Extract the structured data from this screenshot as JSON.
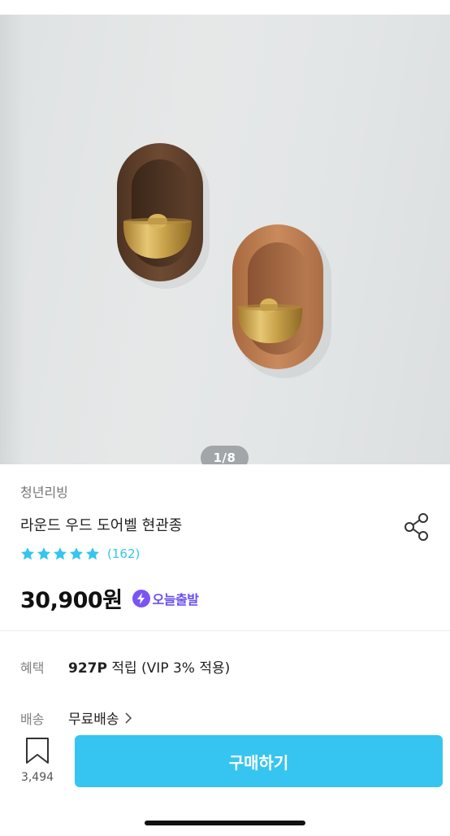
{
  "gallery": {
    "counter": "1/8"
  },
  "product": {
    "store": "청년리빙",
    "title": "라운드 우드 도어벨 현관종",
    "rating": {
      "stars": 5,
      "review_count": "(162)"
    },
    "price": "30,900원",
    "badge_label": "오늘출발"
  },
  "details": {
    "benefit_label": "혜택",
    "benefit_points": "927P",
    "benefit_text": " 적립 (VIP 3% 적용)",
    "shipping_label": "배송",
    "shipping_value": "무료배송"
  },
  "footer": {
    "bookmark_count": "3,494",
    "buy_label": "구매하기"
  },
  "colors": {
    "accent": "#35c5f0",
    "badge": "#6a4ff0"
  },
  "icons": [
    "share-icon",
    "star-icon",
    "bolt-icon",
    "chevron-right-icon",
    "bookmark-icon"
  ]
}
